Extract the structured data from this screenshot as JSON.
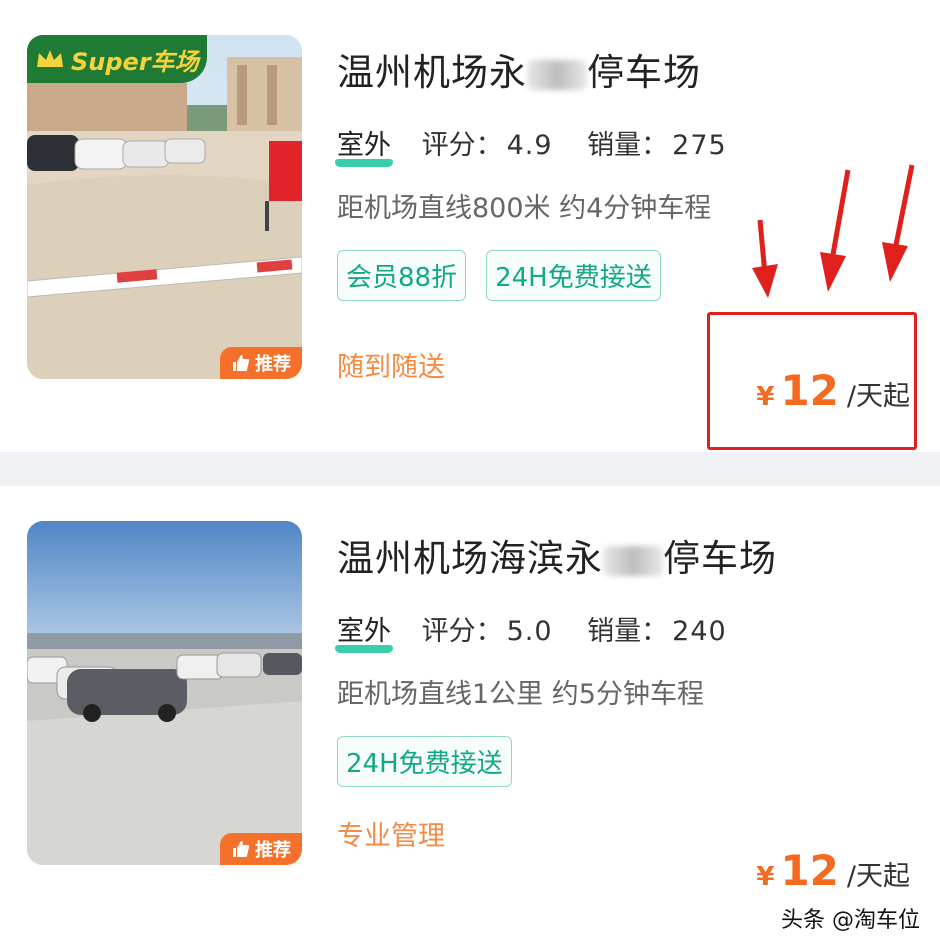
{
  "listings": [
    {
      "title_a": "温州机场永",
      "title_b": "停车场",
      "super_label": "Super车场",
      "tag": "室外",
      "rating_label": "评分：",
      "rating": "4.9",
      "sales_label": "销量：",
      "sales": "275",
      "distance": "距机场直线800米 约4分钟车程",
      "chips": [
        "会员88折",
        "24H免费接送"
      ],
      "feature": "随到随送",
      "badge": "推荐",
      "price_symbol": "¥",
      "price": "12",
      "price_unit": "/天起"
    },
    {
      "title_a": "温州机场海滨永",
      "title_b": "停车场",
      "tag": "室外",
      "rating_label": "评分：",
      "rating": "5.0",
      "sales_label": "销量：",
      "sales": "240",
      "distance": "距机场直线1公里 约5分钟车程",
      "chips": [
        "24H免费接送"
      ],
      "feature": "专业管理",
      "badge": "推荐",
      "price_symbol": "¥",
      "price": "12",
      "price_unit": "/天起"
    }
  ],
  "watermark": "头条 @淘车位",
  "colors": {
    "accent_orange": "#f46a1e",
    "chip_green": "#13a886",
    "annotation_red": "#e0201c",
    "super_green": "#1f7a34"
  }
}
